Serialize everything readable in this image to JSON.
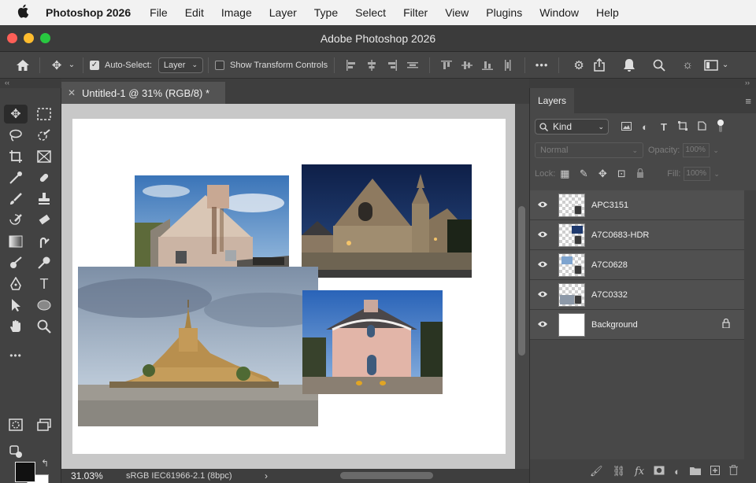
{
  "menubar": {
    "apple": "",
    "app_name": "Photoshop 2026",
    "items": [
      "File",
      "Edit",
      "Image",
      "Layer",
      "Type",
      "Select",
      "Filter",
      "View",
      "Plugins",
      "Window",
      "Help"
    ]
  },
  "window": {
    "title": "Adobe Photoshop 2026"
  },
  "options_bar": {
    "auto_select_label": "Auto-Select:",
    "auto_select_checked": true,
    "auto_select_value": "Layer",
    "show_transform_label": "Show Transform Controls",
    "show_transform_checked": false,
    "more": "•••"
  },
  "strip": {
    "left": "‹‹",
    "right": "››"
  },
  "document": {
    "tab_title": "Untitled-1 @ 31% (RGB/8) *",
    "close": "✕"
  },
  "status": {
    "zoom": "31.03%",
    "profile": "sRGB IEC61966-2.1 (8bpc)",
    "arrow": "›"
  },
  "layers_panel": {
    "tab": "Layers",
    "filter_kind": "Kind",
    "blend_mode": "Normal",
    "opacity_label": "Opacity:",
    "opacity_value": "100%",
    "lock_label": "Lock:",
    "fill_label": "Fill:",
    "fill_value": "100%",
    "layers": [
      {
        "name": "APC3151",
        "type": "smart"
      },
      {
        "name": "A7C0683-HDR",
        "type": "smart"
      },
      {
        "name": "A7C0628",
        "type": "smart"
      },
      {
        "name": "A7C0332",
        "type": "smart"
      },
      {
        "name": "Background",
        "type": "background",
        "locked": true
      }
    ]
  },
  "colors": {
    "foreground": "#111111",
    "background": "#ffffff",
    "panel": "#484848",
    "accent_close": "#fe5f57",
    "accent_min": "#febc2e",
    "accent_max": "#28c840"
  }
}
